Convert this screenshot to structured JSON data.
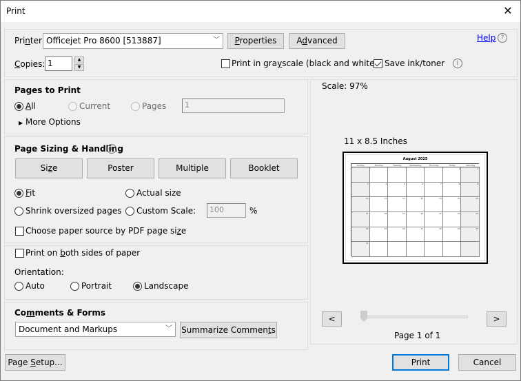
{
  "window": {
    "title": "Print",
    "close_icon": "close-icon"
  },
  "printer": {
    "label": "Printer:",
    "selected": "Officejet Pro 8600 [513887]",
    "properties_label": "Properties",
    "advanced_label": "Advanced",
    "help_label": "Help"
  },
  "copies": {
    "label": "Copies:",
    "value": "1"
  },
  "options": {
    "grayscale_label": "Print in grayscale (black and white)",
    "grayscale_checked": false,
    "save_ink_label": "Save ink/toner",
    "save_ink_checked": true
  },
  "pages_to_print": {
    "heading": "Pages to Print",
    "all_label": "All",
    "current_label": "Current",
    "pages_label": "Pages",
    "pages_value": "1",
    "selected": "All",
    "more_options_label": "More Options"
  },
  "page_sizing": {
    "heading": "Page Sizing & Handling",
    "tabs": [
      "Size",
      "Poster",
      "Multiple",
      "Booklet"
    ],
    "fit_label": "Fit",
    "actual_size_label": "Actual size",
    "shrink_label": "Shrink oversized pages",
    "custom_scale_label": "Custom Scale:",
    "custom_scale_value": "100",
    "percent_label": "%",
    "selected": "Fit",
    "paper_source_label": "Choose paper source by PDF page size",
    "paper_source_checked": false
  },
  "duplex": {
    "both_sides_label": "Print on both sides of paper",
    "both_sides_checked": false,
    "orientation_label": "Orientation:",
    "auto_label": "Auto",
    "portrait_label": "Portrait",
    "landscape_label": "Landscape",
    "selected": "Landscape"
  },
  "comments_forms": {
    "heading": "Comments & Forms",
    "selected": "Document and Markups",
    "summarize_label": "Summarize Comments"
  },
  "preview": {
    "scale_text": "Scale:  97%",
    "paper_size_text": "11 x 8.5 Inches",
    "calendar_title": "August 2025",
    "weekdays": [
      "Sunday",
      "Monday",
      "Tuesday",
      "Wednesday",
      "Thursday",
      "Friday",
      "Saturday"
    ],
    "weeks": [
      [
        "",
        "",
        "",
        "",
        "",
        "1",
        "2"
      ],
      [
        "3",
        "4",
        "5",
        "6",
        "7",
        "8",
        "9"
      ],
      [
        "10",
        "11",
        "12",
        "13",
        "14",
        "15",
        "16"
      ],
      [
        "17",
        "18",
        "19",
        "20",
        "21",
        "22",
        "23"
      ],
      [
        "24",
        "25",
        "26",
        "27",
        "28",
        "29",
        "30"
      ],
      [
        "31",
        "",
        "",
        "",
        "",
        "",
        ""
      ]
    ],
    "prev_label": "<",
    "next_label": ">",
    "page_indicator": "Page 1 of 1",
    "page_position": 1,
    "page_count": 1
  },
  "footer": {
    "page_setup_label": "Page Setup...",
    "print_label": "Print",
    "cancel_label": "Cancel"
  }
}
